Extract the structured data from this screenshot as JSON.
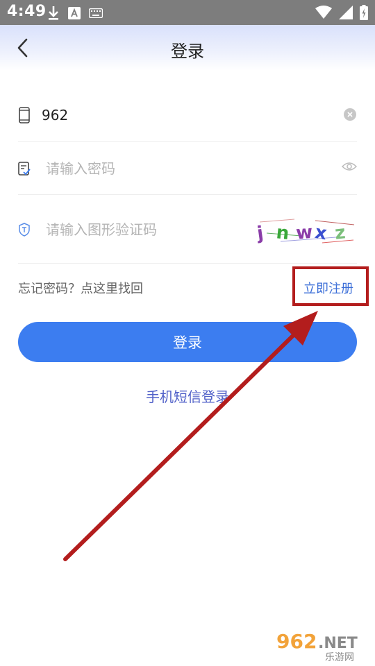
{
  "status_bar": {
    "time": "4:49",
    "icons": [
      "download-icon",
      "font-icon",
      "keyboard-icon",
      "wifi-icon",
      "signal-icon",
      "battery-icon"
    ]
  },
  "header": {
    "title": "登录",
    "back_icon": "chevron-left-icon"
  },
  "form": {
    "phone": {
      "value": "962",
      "icon": "phone-icon",
      "clear_icon": "clear-icon"
    },
    "password": {
      "placeholder": "请输入密码",
      "icon": "password-icon",
      "toggle_icon": "eye-icon"
    },
    "captcha": {
      "placeholder": "请输入图形验证码",
      "icon": "shield-icon",
      "chars": [
        "j",
        "n",
        "w",
        "x",
        "z"
      ],
      "char_colors": [
        "#8a3da8",
        "#3aa83a",
        "#8a3da8",
        "#3a4fd0",
        "#7bbf7b"
      ]
    }
  },
  "links": {
    "forgot": "忘记密码？点这里找回",
    "register": "立即注册"
  },
  "login_button": {
    "label": "登录"
  },
  "sms_login": {
    "label": "手机短信登录"
  },
  "watermark": {
    "brand": "962",
    "suffix": ".NET",
    "subtitle": "乐游网"
  },
  "colors": {
    "primary": "#3c7df0",
    "link": "#3c6fd8",
    "annotation": "#b31d1d",
    "status_bar": "#7d7d7d"
  }
}
